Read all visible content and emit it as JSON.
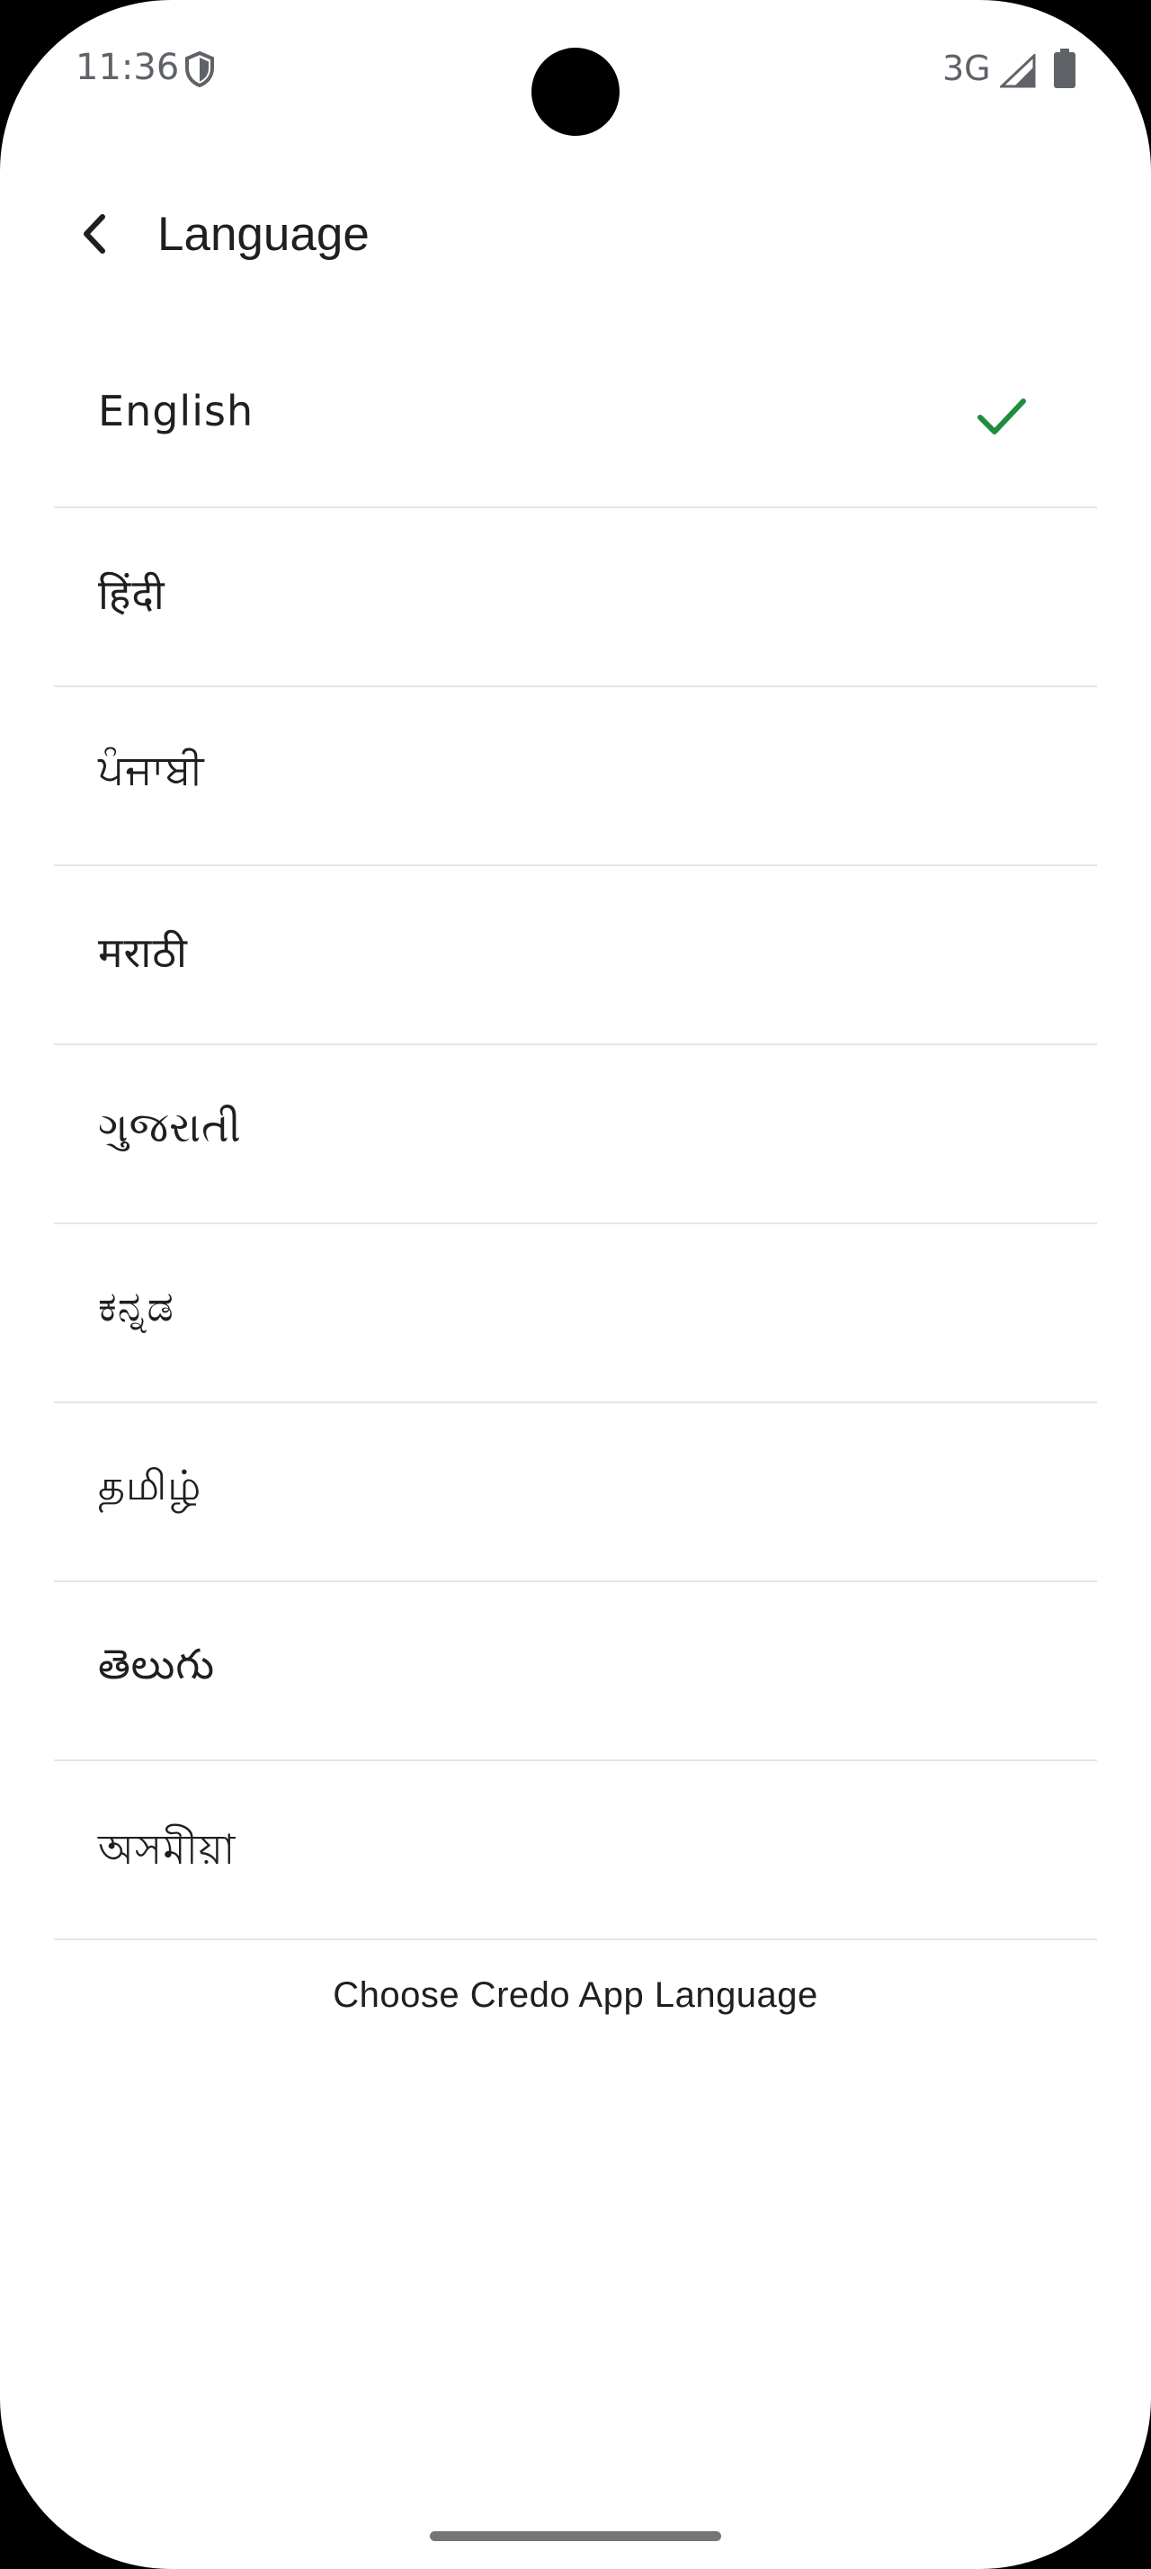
{
  "status_bar": {
    "time": "11:36",
    "network": "3G"
  },
  "header": {
    "title": "Language"
  },
  "languages": [
    {
      "label": "English",
      "selected": true
    },
    {
      "label": "हिंदी",
      "selected": false
    },
    {
      "label": "ਪੰਜਾਬੀ",
      "selected": false
    },
    {
      "label": "मराठी",
      "selected": false
    },
    {
      "label": "ગુજરાતી",
      "selected": false
    },
    {
      "label": "ಕನ್ನಡ",
      "selected": false
    },
    {
      "label": "தமிழ்",
      "selected": false
    },
    {
      "label": "తెలుగు",
      "selected": false
    },
    {
      "label": "অসমীয়া",
      "selected": false
    }
  ],
  "footer": {
    "caption": "Choose Credo App Language"
  },
  "colors": {
    "check": "#1e8e3e",
    "divider": "#e6e6e6",
    "text": "#1f1f1f"
  }
}
